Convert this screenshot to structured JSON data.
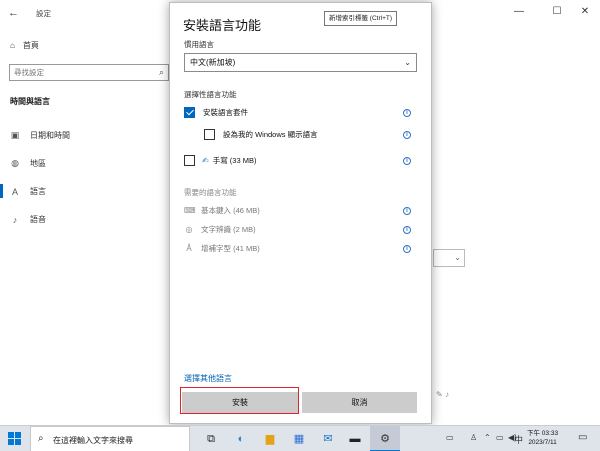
{
  "settings": {
    "app_title": "設定",
    "home_label": "首頁",
    "search_placeholder": "尋找設定",
    "section_label": "時間與語言",
    "nav_items": [
      {
        "label": "日期和時間",
        "icon": "calendar-clock-icon"
      },
      {
        "label": "地區",
        "icon": "globe-icon"
      },
      {
        "label": "語言",
        "icon": "language-icon"
      },
      {
        "label": "語音",
        "icon": "microphone-icon"
      }
    ],
    "window_controls": {
      "minimize": "—",
      "maximize": "☐",
      "close": "✕"
    }
  },
  "dialog": {
    "title": "安裝語言功能",
    "tooltip": "新增索引標籤 (Ctrl+T)",
    "preferred_language_label": "慣用語言",
    "selected_language": "中文(新加坡)",
    "optional_heading": "選擇性語言功能",
    "options": [
      {
        "label": "安裝語言套件",
        "checked": true
      },
      {
        "label": "設為我的 Windows 顯示語言",
        "checked": false
      },
      {
        "label": "手寫 (33 MB)",
        "checked": false
      }
    ],
    "required_heading": "需要的語言功能",
    "required": [
      {
        "label": "基本鍵入 (46 MB)",
        "icon": "keyboard-icon"
      },
      {
        "label": "文字辨識 (2 MB)",
        "icon": "ocr-icon"
      },
      {
        "label": "增補字型 (41 MB)",
        "icon": "font-icon"
      }
    ],
    "more_link": "選擇其他語言",
    "install_label": "安裝",
    "cancel_label": "取消"
  },
  "taskbar": {
    "search_placeholder": "在這裡輸入文字來搜尋",
    "ime_label": "中",
    "time": "下午 03:33",
    "date": "2023/7/11",
    "accent_color": "#0078d4"
  }
}
